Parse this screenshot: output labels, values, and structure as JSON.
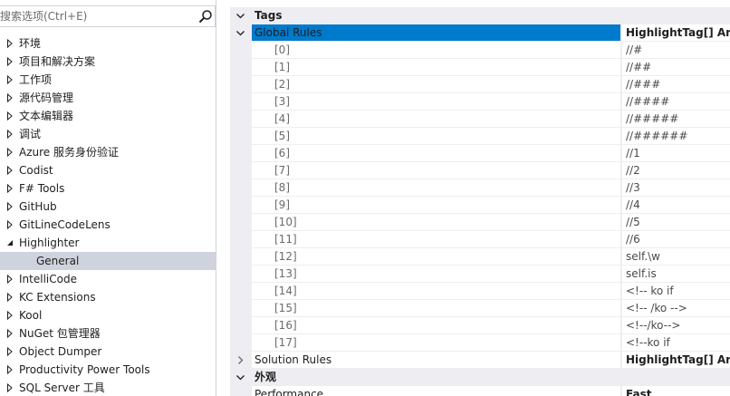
{
  "search": {
    "placeholder": "搜索选项(Ctrl+E)"
  },
  "tree": [
    {
      "label": "环境",
      "expanded": false
    },
    {
      "label": "项目和解决方案",
      "expanded": false
    },
    {
      "label": "工作项",
      "expanded": false
    },
    {
      "label": "源代码管理",
      "expanded": false
    },
    {
      "label": "文本编辑器",
      "expanded": false
    },
    {
      "label": "调试",
      "expanded": false
    },
    {
      "label": "Azure 服务身份验证",
      "expanded": false
    },
    {
      "label": "Codist",
      "expanded": false
    },
    {
      "label": "F# Tools",
      "expanded": false
    },
    {
      "label": "GitHub",
      "expanded": false
    },
    {
      "label": "GitLineCodeLens",
      "expanded": false
    },
    {
      "label": "Highlighter",
      "expanded": true
    },
    {
      "label": "General",
      "child": true,
      "selected": true
    },
    {
      "label": "IntelliCode",
      "expanded": false
    },
    {
      "label": "KC Extensions",
      "expanded": false
    },
    {
      "label": "Kool",
      "expanded": false
    },
    {
      "label": "NuGet 包管理器",
      "expanded": false
    },
    {
      "label": "Object Dumper",
      "expanded": false
    },
    {
      "label": "Productivity Power Tools",
      "expanded": false
    },
    {
      "label": "SQL Server 工具",
      "expanded": false
    }
  ],
  "grid": {
    "category_tags": "Tags",
    "global_rules": {
      "name": "Global Rules",
      "value": "HighlightTag[] Array"
    },
    "items": [
      {
        "index": "[0]",
        "value": "//#"
      },
      {
        "index": "[1]",
        "value": "//##"
      },
      {
        "index": "[2]",
        "value": "//###"
      },
      {
        "index": "[3]",
        "value": "//####"
      },
      {
        "index": "[4]",
        "value": "//#####"
      },
      {
        "index": "[5]",
        "value": "//######"
      },
      {
        "index": "[6]",
        "value": "//1"
      },
      {
        "index": "[7]",
        "value": "//2"
      },
      {
        "index": "[8]",
        "value": "//3"
      },
      {
        "index": "[9]",
        "value": "//4"
      },
      {
        "index": "[10]",
        "value": "//5"
      },
      {
        "index": "[11]",
        "value": "//6"
      },
      {
        "index": "[12]",
        "value": "self.\\w"
      },
      {
        "index": "[13]",
        "value": "self.is"
      },
      {
        "index": "[14]",
        "value": "<!-- ko if"
      },
      {
        "index": "[15]",
        "value": "<!-- /ko -->"
      },
      {
        "index": "[16]",
        "value": "<!--/ko-->"
      },
      {
        "index": "[17]",
        "value": "<!--ko if"
      }
    ],
    "solution_rules": {
      "name": "Solution Rules",
      "value": "HighlightTag[] Array"
    },
    "category_appearance": "外观",
    "performance": {
      "name": "Performance",
      "value": "Fast"
    }
  },
  "colors": {
    "selection": "#007acc",
    "tree_selection": "#cfd3dd",
    "gutter": "#eeeef2"
  }
}
